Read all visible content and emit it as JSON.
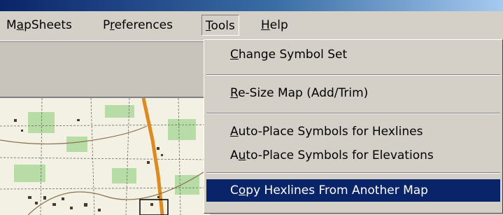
{
  "menubar": {
    "items": [
      {
        "label": "MapSheets",
        "mnemonic": "a"
      },
      {
        "label": "Preferences",
        "mnemonic": "r"
      },
      {
        "label": "Tools",
        "mnemonic": "T"
      },
      {
        "label": "Help",
        "mnemonic": "H"
      }
    ],
    "open_menu": "Tools"
  },
  "tools_menu": {
    "items": [
      {
        "label": "Change Symbol Set",
        "mnemonic": "C",
        "selected": false
      },
      {
        "label": "Re-Size Map (Add/Trim)",
        "mnemonic": "R",
        "selected": false
      },
      {
        "label": "Auto-Place Symbols for Hexlines",
        "mnemonic": "A",
        "selected": false
      },
      {
        "label": "Auto-Place Symbols for Elevations",
        "mnemonic": "u",
        "selected": false
      },
      {
        "label": "Copy Hexlines From Another Map",
        "mnemonic": "o",
        "selected": true
      }
    ]
  },
  "colors": {
    "menu_bg": "#d4d0c8",
    "highlight": "#0a246a",
    "highlight_text": "#ffffff",
    "map_bg": "#f3f1e4",
    "road": "#e08a1e",
    "woods": "#b7dca6"
  }
}
